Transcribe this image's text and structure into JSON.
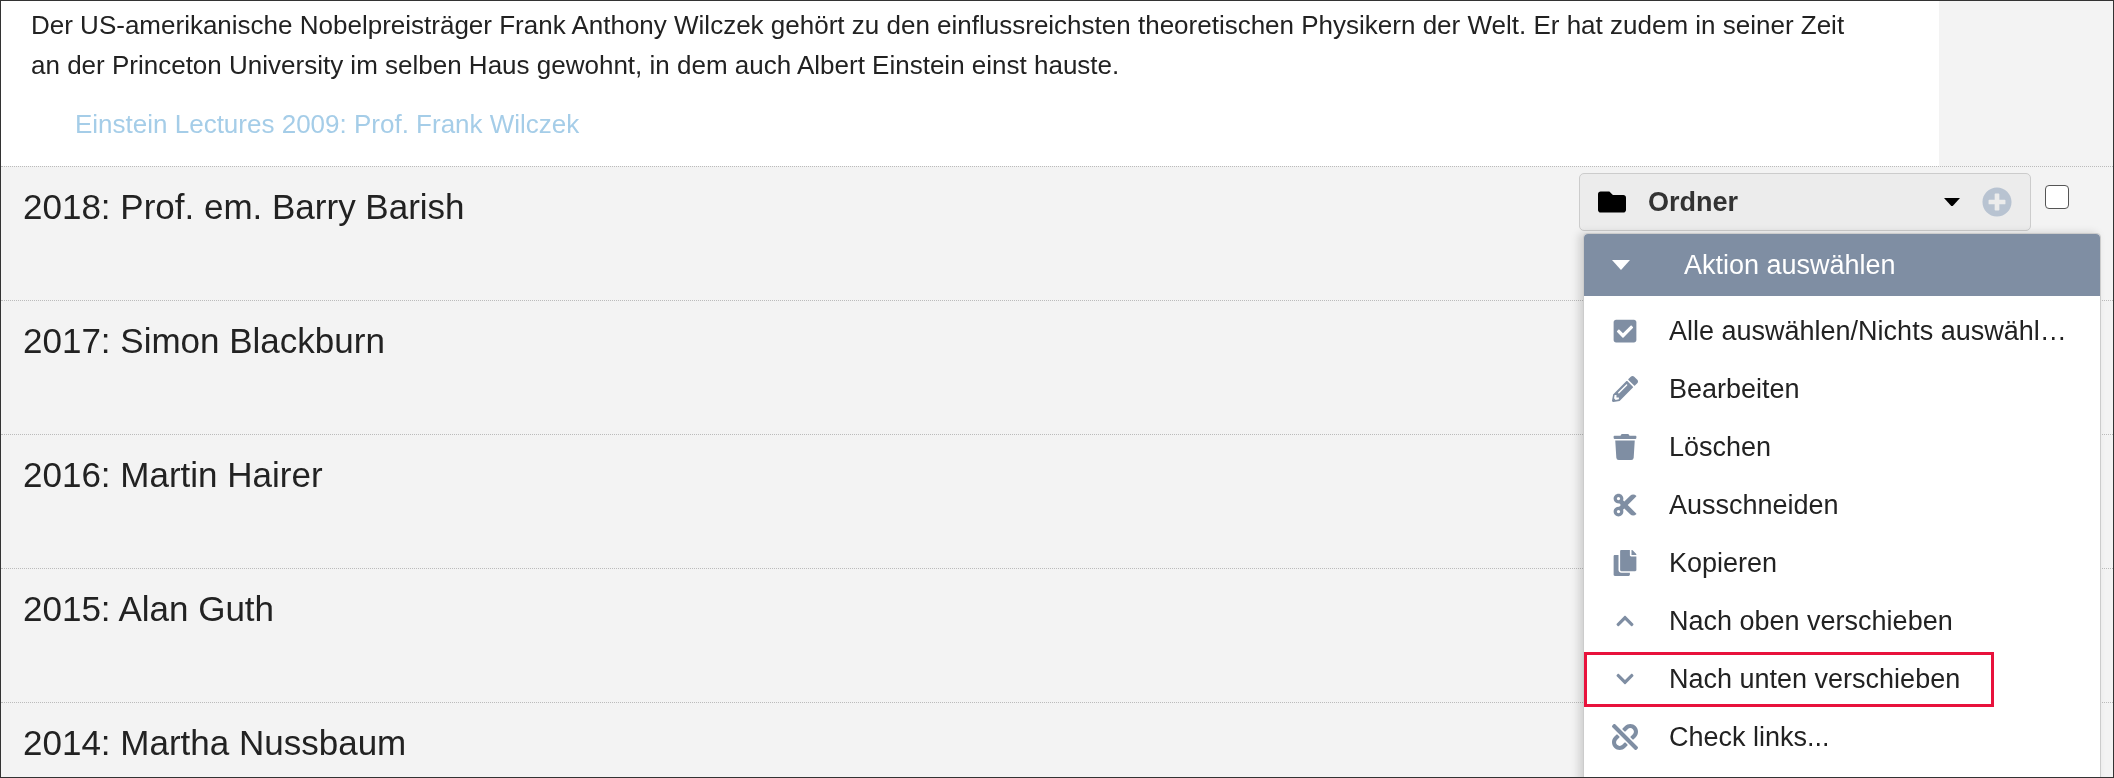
{
  "intro": {
    "text": "Der US-amerikanische Nobelpreisträger Frank Anthony Wilczek gehört zu den einflussreichsten theoretischen Physikern der Welt. Er hat zudem in seiner Zeit an der Princeton University im selben Haus gewohnt, in dem auch Albert Einstein einst hauste.",
    "link": "Einstein Lectures 2009: Prof. Frank Wilczek"
  },
  "rows": [
    {
      "title": "2018: Prof. em. Barry Barish"
    },
    {
      "title": "2017: Simon Blackburn"
    },
    {
      "title": "2016: Martin Hairer"
    },
    {
      "title": "2015: Alan Guth"
    },
    {
      "title": "2014: Martha Nussbaum"
    }
  ],
  "folder_select": {
    "label": "Ordner",
    "checked": false
  },
  "action_menu": {
    "title": "Aktion auswählen",
    "items": [
      {
        "kind": "select-all",
        "label": "Alle auswählen/Nichts auswähl…",
        "highlighted": false
      },
      {
        "kind": "edit",
        "label": "Bearbeiten",
        "highlighted": false
      },
      {
        "kind": "delete",
        "label": "Löschen",
        "highlighted": false
      },
      {
        "kind": "cut",
        "label": "Ausschneiden",
        "highlighted": false
      },
      {
        "kind": "copy",
        "label": "Kopieren",
        "highlighted": false
      },
      {
        "kind": "move-up",
        "label": "Nach oben verschieben",
        "highlighted": false
      },
      {
        "kind": "move-down",
        "label": "Nach unten verschieben",
        "highlighted": true
      },
      {
        "kind": "check-links",
        "label": "Check links...",
        "highlighted": false
      }
    ]
  }
}
